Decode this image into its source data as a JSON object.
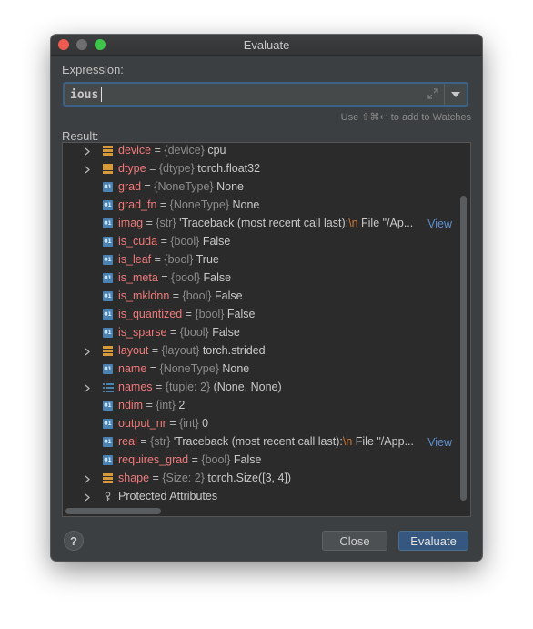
{
  "window": {
    "title": "Evaluate"
  },
  "expression": {
    "label": "Expression:",
    "value": "ious"
  },
  "hint": "Use ⇧⌘↩ to add to Watches",
  "result": {
    "label": "Result:",
    "rows": [
      {
        "expandable": true,
        "icon": "object-icon",
        "name": "device",
        "type": "{device}",
        "value": "cpu"
      },
      {
        "expandable": true,
        "icon": "object-icon",
        "name": "dtype",
        "type": "{dtype}",
        "value": "torch.float32"
      },
      {
        "expandable": false,
        "icon": "field-icon",
        "name": "grad",
        "type": "{NoneType}",
        "value": "None"
      },
      {
        "expandable": false,
        "icon": "field-icon",
        "name": "grad_fn",
        "type": "{NoneType}",
        "value": "None"
      },
      {
        "expandable": false,
        "icon": "field-icon",
        "name": "imag",
        "type": "{str}",
        "value": "'Traceback (most recent call last):",
        "escape": "\\n",
        "tail": "  File \"/Ap...",
        "link": "View"
      },
      {
        "expandable": false,
        "icon": "field-icon",
        "name": "is_cuda",
        "type": "{bool}",
        "value": "False"
      },
      {
        "expandable": false,
        "icon": "field-icon",
        "name": "is_leaf",
        "type": "{bool}",
        "value": "True"
      },
      {
        "expandable": false,
        "icon": "field-icon",
        "name": "is_meta",
        "type": "{bool}",
        "value": "False"
      },
      {
        "expandable": false,
        "icon": "field-icon",
        "name": "is_mkldnn",
        "type": "{bool}",
        "value": "False"
      },
      {
        "expandable": false,
        "icon": "field-icon",
        "name": "is_quantized",
        "type": "{bool}",
        "value": "False"
      },
      {
        "expandable": false,
        "icon": "field-icon",
        "name": "is_sparse",
        "type": "{bool}",
        "value": "False"
      },
      {
        "expandable": true,
        "icon": "object-icon",
        "name": "layout",
        "type": "{layout}",
        "value": "torch.strided"
      },
      {
        "expandable": false,
        "icon": "field-icon",
        "name": "name",
        "type": "{NoneType}",
        "value": "None"
      },
      {
        "expandable": true,
        "icon": "list-icon",
        "name": "names",
        "type": "{tuple: 2}",
        "value": "(None, None)"
      },
      {
        "expandable": false,
        "icon": "field-icon",
        "name": "ndim",
        "type": "{int}",
        "value": "2"
      },
      {
        "expandable": false,
        "icon": "field-icon",
        "name": "output_nr",
        "type": "{int}",
        "value": "0"
      },
      {
        "expandable": false,
        "icon": "field-icon",
        "name": "real",
        "type": "{str}",
        "value": "'Traceback (most recent call last):",
        "escape": "\\n",
        "tail": "  File \"/App...",
        "link": "View"
      },
      {
        "expandable": false,
        "icon": "field-icon",
        "name": "requires_grad",
        "type": "{bool}",
        "value": "False"
      },
      {
        "expandable": true,
        "icon": "object-icon",
        "name": "shape",
        "type": "{Size: 2}",
        "value": "torch.Size([3, 4])"
      },
      {
        "expandable": true,
        "icon": "key-icon",
        "name": "Protected Attributes",
        "type": "",
        "value": "",
        "plain": true
      }
    ]
  },
  "buttons": {
    "help": "?",
    "close": "Close",
    "evaluate": "Evaluate"
  },
  "colors": {
    "accent": "#365880",
    "name": "#ef7a7a",
    "link": "#5a8ed0"
  }
}
